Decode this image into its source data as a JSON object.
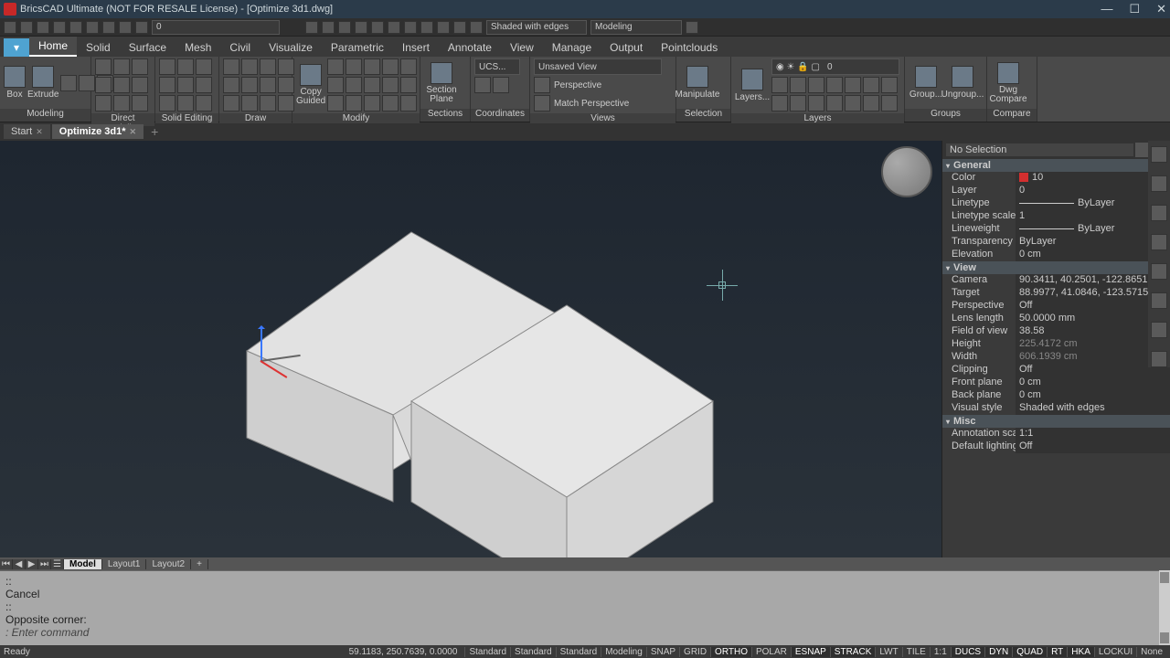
{
  "window_title": "BricsCAD Ultimate (NOT FOR RESALE License) - [Optimize 3d1.dwg]",
  "qat": {
    "visual_style": "Shaded with edges",
    "workspace": "Modeling",
    "byLayer": "0"
  },
  "tabs": [
    "Home",
    "Solid",
    "Surface",
    "Mesh",
    "Civil",
    "Visualize",
    "Parametric",
    "Insert",
    "Annotate",
    "View",
    "Manage",
    "Output",
    "Pointclouds"
  ],
  "panels": {
    "modeling": {
      "label": "Modeling",
      "box": "Box",
      "extrude": "Extrude"
    },
    "direct": "Direct Modeling",
    "solid_edit": "Solid Editing",
    "draw": "Draw",
    "modify": {
      "label": "Modify",
      "copy": "Copy\nGuided"
    },
    "sections": {
      "label": "Sections",
      "section": "Section\nPlane"
    },
    "coords": {
      "label": "Coordinates",
      "ucs": "UCS..."
    },
    "views": {
      "label": "Views",
      "unsaved": "Unsaved View",
      "persp": "Perspective",
      "match": "Match Perspective"
    },
    "selection": {
      "label": "Selection",
      "manip": "Manipulate"
    },
    "layers": {
      "label": "Layers",
      "layers": "Layers...",
      "combo": "0"
    },
    "groups": {
      "label": "Groups",
      "group": "Group...",
      "ungroup": "Ungroup..."
    },
    "compare": {
      "label": "Compare",
      "dwg": "Dwg\nCompare"
    }
  },
  "doc_tabs": {
    "start": "Start",
    "active": "Optimize 3d1*"
  },
  "properties": {
    "selection": "No Selection",
    "groups": {
      "general": "General",
      "view": "View",
      "misc": "Misc"
    },
    "general": [
      {
        "k": "Color",
        "v": "10",
        "swatch": true
      },
      {
        "k": "Layer",
        "v": "0"
      },
      {
        "k": "Linetype",
        "v": "ByLayer",
        "line": true
      },
      {
        "k": "Linetype scale",
        "v": "1"
      },
      {
        "k": "Lineweight",
        "v": "ByLayer",
        "line": true
      },
      {
        "k": "Transparency",
        "v": "ByLayer"
      },
      {
        "k": "Elevation",
        "v": "0 cm"
      }
    ],
    "view": [
      {
        "k": "Camera",
        "v": "90.3411, 40.2501, -122.8651"
      },
      {
        "k": "Target",
        "v": "88.9977, 41.0846, -123.5715"
      },
      {
        "k": "Perspective",
        "v": "Off"
      },
      {
        "k": "Lens length",
        "v": "50.0000 mm"
      },
      {
        "k": "Field of view",
        "v": "38.58"
      },
      {
        "k": "Height",
        "v": "225.4172 cm",
        "dim": true
      },
      {
        "k": "Width",
        "v": "606.1939 cm",
        "dim": true
      },
      {
        "k": "Clipping",
        "v": "Off"
      },
      {
        "k": "Front plane",
        "v": "0 cm"
      },
      {
        "k": "Back plane",
        "v": "0 cm"
      },
      {
        "k": "Visual style",
        "v": "Shaded with edges"
      }
    ],
    "misc": [
      {
        "k": "Annotation scale",
        "v": "1:1"
      },
      {
        "k": "Default lighting",
        "v": "Off"
      }
    ]
  },
  "layout_tabs": [
    "Model",
    "Layout1",
    "Layout2"
  ],
  "command": {
    "history": [
      "::",
      "Cancel",
      "::",
      "Opposite corner:"
    ],
    "prompt": ": Enter command"
  },
  "status": {
    "ready": "Ready",
    "coords": "59.1183, 250.7639, 0.0000",
    "buttons": [
      "Standard",
      "Standard",
      "Standard",
      "Modeling",
      "SNAP",
      "GRID",
      "ORTHO",
      "POLAR",
      "ESNAP",
      "STRACK",
      "LWT",
      "TILE",
      "1:1",
      "DUCS",
      "DYN",
      "QUAD",
      "RT",
      "HKA",
      "LOCKUI",
      "None"
    ]
  }
}
